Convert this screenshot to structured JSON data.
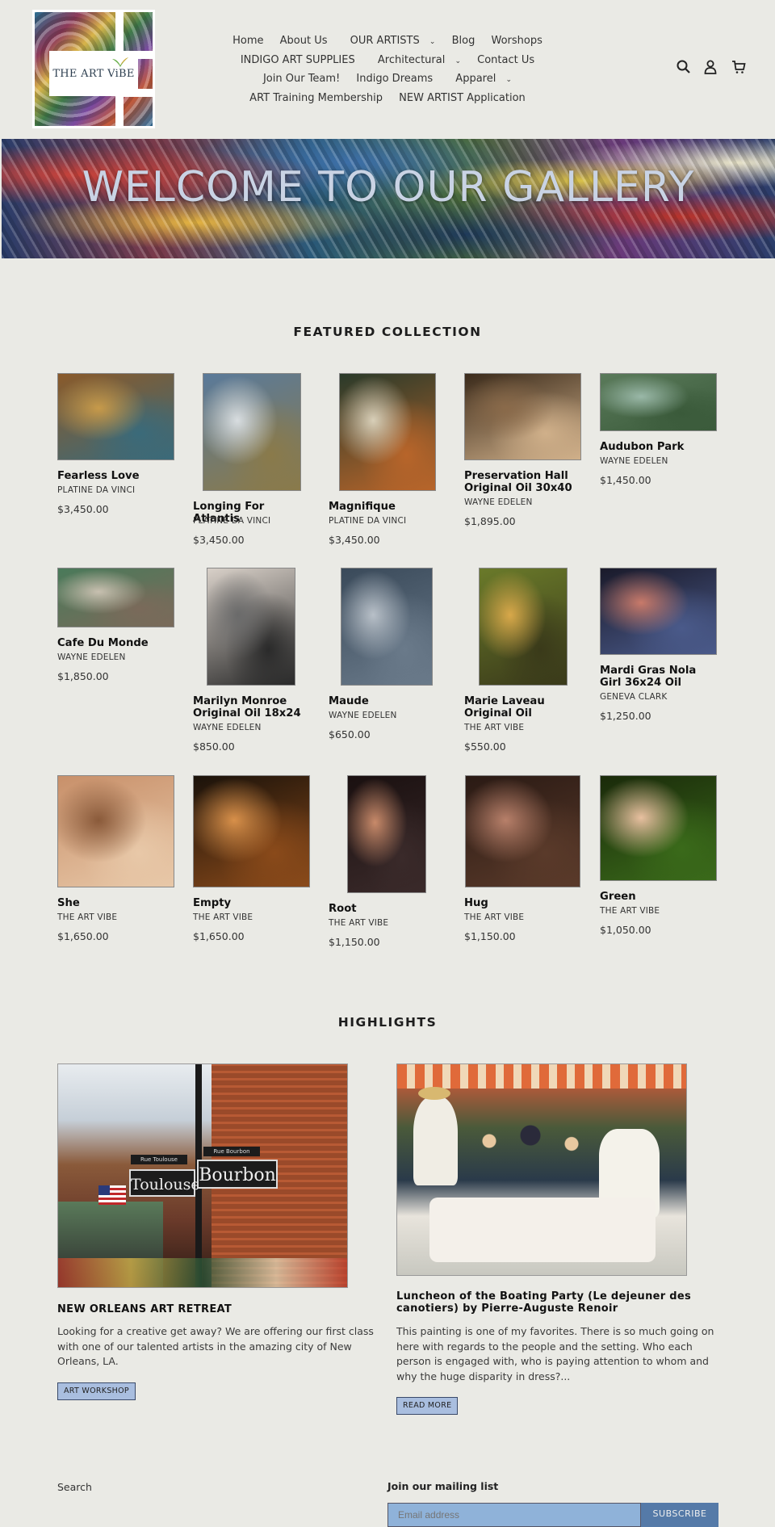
{
  "brand": {
    "logo_text": "THE ART ViBE"
  },
  "nav": {
    "items": [
      {
        "label": "Home"
      },
      {
        "label": "About Us"
      },
      {
        "label": "OUR ARTISTS",
        "dropdown": true
      },
      {
        "label": "Blog"
      },
      {
        "label": "Worshops"
      },
      {
        "label": "INDIGO ART SUPPLIES"
      },
      {
        "label": "Architectural",
        "dropdown": true
      },
      {
        "label": "Contact Us"
      },
      {
        "label": "Join Our Team!"
      },
      {
        "label": "Indigo Dreams"
      },
      {
        "label": "Apparel",
        "dropdown": true
      },
      {
        "label": "ART Training Membership"
      },
      {
        "label": "NEW ARTIST Application"
      }
    ],
    "icons": [
      "search-icon",
      "account-icon",
      "cart-icon"
    ]
  },
  "hero": {
    "title": "WELCOME TO OUR GALLERY"
  },
  "featured": {
    "title": "FEATURED COLLECTION",
    "products": [
      {
        "title": "Fearless Love",
        "vendor": "PLATINE DA VINCI",
        "price": "$3,450.00",
        "colors": [
          "#8a5a2a",
          "#c79a4a",
          "#3a6a7a"
        ]
      },
      {
        "title": "Longing For Atlantis",
        "vendor": "PLATINE DA VINCI",
        "price": "$3,450.00",
        "colors": [
          "#5a7a9a",
          "#d8dde0",
          "#8a7a4a"
        ]
      },
      {
        "title": "Magnifique",
        "vendor": "PLATINE DA VINCI",
        "price": "$3,450.00",
        "colors": [
          "#2a3a2a",
          "#d8cfb8",
          "#b8652a"
        ]
      },
      {
        "title": "Preservation Hall Original Oil 30x40",
        "vendor": "WAYNE EDELEN",
        "price": "$1,895.00",
        "colors": [
          "#3a2a1a",
          "#8a6a4a",
          "#d0b08a"
        ]
      },
      {
        "title": "Audubon Park",
        "vendor": "WAYNE EDELEN",
        "price": "$1,450.00",
        "colors": [
          "#5a7a5a",
          "#9ab8a8",
          "#3a5a3a"
        ]
      },
      {
        "title": "Cafe Du Monde",
        "vendor": "WAYNE EDELEN",
        "price": "$1,850.00",
        "colors": [
          "#4a7a5a",
          "#c8c0b0",
          "#7a6a5a"
        ]
      },
      {
        "title": "Marilyn Monroe Original Oil 18x24",
        "vendor": "WAYNE EDELEN",
        "price": "$850.00",
        "colors": [
          "#d8d0c8",
          "#6a6a6a",
          "#2a2a2a"
        ]
      },
      {
        "title": "Maude",
        "vendor": "WAYNE EDELEN",
        "price": "$650.00",
        "colors": [
          "#3a4a5a",
          "#b8c0c8",
          "#6a7a8a"
        ]
      },
      {
        "title": "Marie Laveau Original Oil",
        "vendor": "THE ART VIBE",
        "price": "$550.00",
        "colors": [
          "#6a7a2a",
          "#d8a84a",
          "#3a3a1a"
        ]
      },
      {
        "title": "Mardi Gras Nola Girl 36x24 Oil",
        "vendor": "GENEVA CLARK",
        "price": "$1,250.00",
        "colors": [
          "#1a1a2a",
          "#c87a6a",
          "#4a5a8a"
        ]
      },
      {
        "title": "She",
        "vendor": "THE ART VIBE",
        "price": "$1,650.00",
        "colors": [
          "#c8906a",
          "#8a5a3a",
          "#e8c8a8"
        ]
      },
      {
        "title": "Empty",
        "vendor": "THE ART VIBE",
        "price": "$1,650.00",
        "colors": [
          "#1a120a",
          "#d8904a",
          "#8a4a1a"
        ]
      },
      {
        "title": "Root",
        "vendor": "THE ART VIBE",
        "price": "$1,150.00",
        "colors": [
          "#1a1010",
          "#c88a6a",
          "#3a2a2a"
        ]
      },
      {
        "title": "Hug",
        "vendor": "THE ART VIBE",
        "price": "$1,150.00",
        "colors": [
          "#2a1a14",
          "#b8806a",
          "#5a3a2a"
        ]
      },
      {
        "title": "Green",
        "vendor": "THE ART VIBE",
        "price": "$1,050.00",
        "colors": [
          "#1a2a0a",
          "#e8c0a0",
          "#3a6a1a"
        ]
      }
    ]
  },
  "highlights": {
    "title": "HIGHLIGHTS",
    "posts": [
      {
        "title": "NEW ORLEANS ART RETREAT",
        "excerpt": "Looking for a creative get away?  We are offering our first class with one of our talented artists in the amazing city of New Orleans, LA.",
        "button": "ART WORKSHOP",
        "sign_left": "Toulouse",
        "sign_right": "Bourbon",
        "sign_small_left": "Rue Toulouse",
        "sign_small_right": "Rue Bourbon"
      },
      {
        "title": "Luncheon of the Boating Party (Le dejeuner des canotiers) by Pierre-Auguste Renoir",
        "excerpt": "This painting is one of my favorites. There is so much going on here with regards to the people and the setting. Who each person is engaged with, who is paying attention to whom and why the huge disparity in dress?...",
        "button": "READ MORE"
      }
    ]
  },
  "footer": {
    "link": "Search",
    "mailing_title": "Join our mailing list",
    "email_placeholder": "Email address",
    "subscribe": "SUBSCRIBE"
  }
}
